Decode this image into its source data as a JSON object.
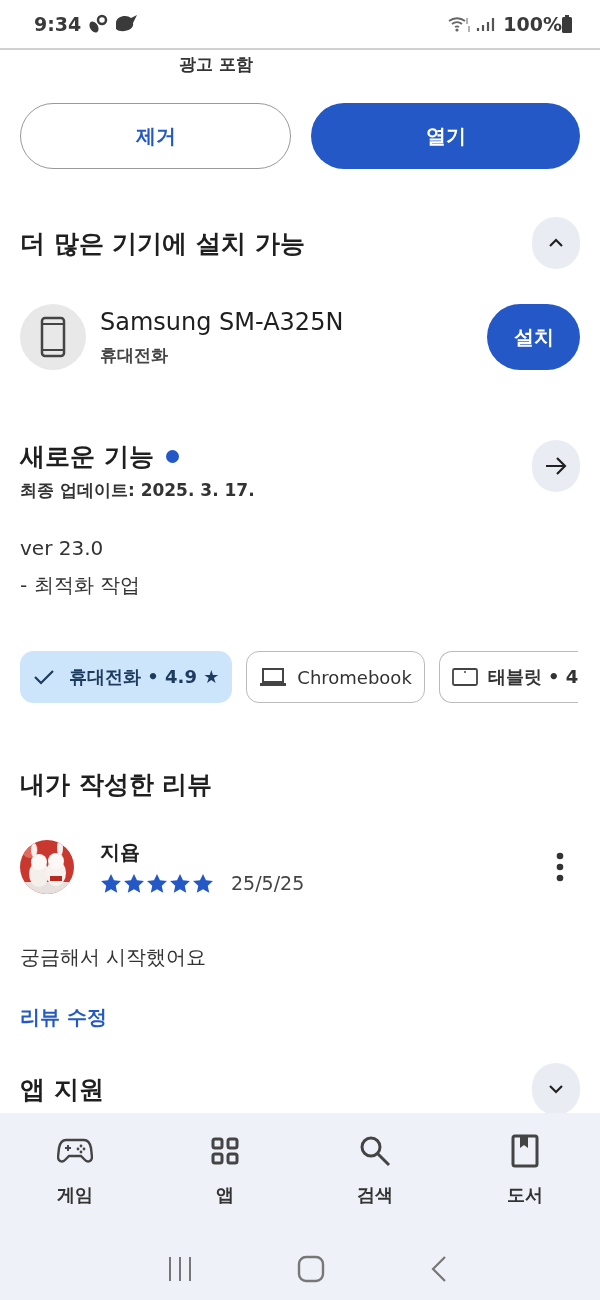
{
  "status_bar": {
    "time": "9:34",
    "battery": "100%"
  },
  "ad_note": "광고 포함",
  "actions": [
    {
      "label": "제거",
      "kind": "outline"
    },
    {
      "label": "열기",
      "kind": "filled"
    }
  ],
  "devices_section": {
    "title": "더 많은 기기에 설치 가능",
    "expanded": true,
    "device": {
      "name": "Samsung SM-A325N",
      "type": "휴대전화",
      "button": "설치"
    }
  },
  "whats_new": {
    "title": "새로운 기능",
    "new": true,
    "updated": "최종 업데이트: 2025. 3. 17.",
    "lines": [
      "ver 23.0",
      "- 최적화 작업"
    ]
  },
  "device_chips": [
    {
      "label": "휴대전화 • 4.9 ★",
      "kind": "check",
      "selected": true
    },
    {
      "label": "Chromebook",
      "kind": "laptop",
      "selected": false
    },
    {
      "label": "태블릿 • 4",
      "kind": "tablet",
      "selected": false
    }
  ],
  "my_review": {
    "title": "내가 작성한 리뷰",
    "author": "지욥",
    "stars": 5,
    "date": "25/5/25",
    "text": "궁금해서 시작했어요",
    "edit": "리뷰 수정"
  },
  "app_support": {
    "title": "앱 지원",
    "expanded": false
  },
  "bottom_nav": [
    {
      "label": "게임",
      "kind": "games",
      "selected": false
    },
    {
      "label": "앱",
      "kind": "apps",
      "selected": false
    },
    {
      "label": "검색",
      "kind": "search",
      "selected": false
    },
    {
      "label": "도서",
      "kind": "books",
      "selected": false
    }
  ]
}
